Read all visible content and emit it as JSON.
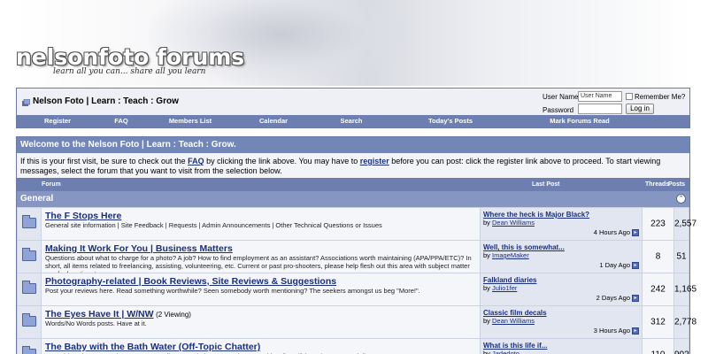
{
  "header": {
    "logo_text": "nelsonfoto forums",
    "tagline": "learn all you can... share all you learn"
  },
  "navbar": {
    "breadcrumb": "Nelson Foto | Learn : Teach : Grow",
    "login": {
      "username_label": "User Name",
      "username_value": "User Name",
      "remember_label": "Remember Me?",
      "password_label": "Password",
      "login_button": "Log in"
    },
    "menu": [
      {
        "label": "Register"
      },
      {
        "label": "FAQ"
      },
      {
        "label": "Members List"
      },
      {
        "label": "Calendar"
      },
      {
        "label": "Search"
      },
      {
        "label": "Today's Posts"
      },
      {
        "label": "Mark Forums Read"
      }
    ]
  },
  "welcome": {
    "title": "Welcome to the Nelson Foto | Learn : Teach : Grow.",
    "text_1": "If this is your first visit, be sure to check out the ",
    "faq_link": "FAQ",
    "text_2": " by clicking the link above. You may have to ",
    "register_link": "register",
    "text_3": " before you can post: click the register link above to proceed. To start viewing messages, select the forum that you want to visit from the selection below."
  },
  "forum_table": {
    "headers": {
      "forum": "Forum",
      "last_post": "Last Post",
      "threads": "Threads",
      "posts": "Posts"
    },
    "category": "General",
    "forums": [
      {
        "title": "The F Stops Here",
        "viewing": "",
        "description": "General site information | Site Feedback | Requests | Admin Announcements | Other Technical Questions or Issues",
        "last_title": "Where the heck is Major Black?",
        "last_by": "by ",
        "last_user": "Dean Williams",
        "last_time": "4 Hours Ago",
        "threads": "223",
        "posts": "2,557"
      },
      {
        "title": "Making It Work For You | Business Matters",
        "viewing": "",
        "description": "Questions about what to charge for a photo? A job? How to find employment as an assistant? Associations worth maintaining (APA/PPA/ETC)? In short, all items related to freelancing, assisting, volunteering, etc. Current or past pro-shooters, please help flesh out this area with subject matter you feel pertinent.",
        "last_title": "Well, this is somewhat...",
        "last_by": "by ",
        "last_user": "ImageMaker",
        "last_time": "1 Day Ago",
        "threads": "8",
        "posts": "51"
      },
      {
        "title": "Photography-related | Book Reviews, Site Reviews & Suggestions",
        "viewing": "",
        "description": "Post your reviews here. Read something worthwhile? Seen somebody worth mentioning? The seekers amongst us beg \"More!\".",
        "last_title": "Falkland diaries",
        "last_by": "by ",
        "last_user": "Julio1fer",
        "last_time": "2 Days Ago",
        "threads": "242",
        "posts": "1,165"
      },
      {
        "title": "The Eyes Have It | W/NW",
        "viewing": "(2 Viewing)",
        "description": "Words/No Words posts. Have at it.",
        "last_title": "Classic film decals",
        "last_by": "by ",
        "last_user": "Dean Williams",
        "last_time": "3 Hours Ago",
        "threads": "312",
        "posts": "2,778"
      },
      {
        "title": "The Baby with the Bath Water (Off-Topic Chatter)",
        "viewing": "",
        "description": "Everything else. General convo, sports-talk, etc. Include a caveat in your subject lines if threads are potentially NOT SAFE FOR",
        "last_title": "What is this life if...",
        "last_by": "by ",
        "last_user": "Jadedoto",
        "last_time": "",
        "threads": "110",
        "posts": "902"
      }
    ]
  },
  "colors": {
    "header_blue": "#6c7fb0",
    "category_blue": "#8696c2",
    "link_blue": "#1a2f7a"
  }
}
